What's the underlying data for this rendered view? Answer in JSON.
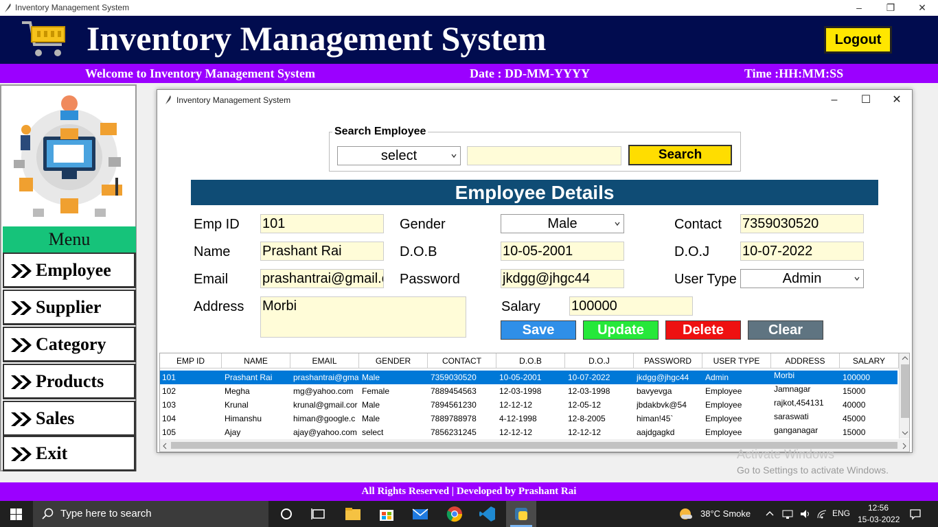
{
  "window": {
    "title": "Inventory Management System"
  },
  "banner": {
    "title": "Inventory Management System",
    "logout_label": "Logout"
  },
  "infobar": {
    "welcome": "Welcome to Inventory Management System",
    "date": "Date : DD-MM-YYYY",
    "time": "Time :HH:MM:SS"
  },
  "menu": {
    "heading": "Menu",
    "items": [
      {
        "label": "Employee"
      },
      {
        "label": "Supplier"
      },
      {
        "label": "Category"
      },
      {
        "label": "Products"
      },
      {
        "label": "Sales"
      },
      {
        "label": "Exit"
      }
    ]
  },
  "inner": {
    "title": "Inventory Management System",
    "search": {
      "legend": "Search Employee",
      "select_value": "select",
      "text_value": "",
      "button_label": "Search"
    },
    "details_heading": "Employee Details",
    "form": {
      "emp_id": {
        "label": "Emp ID",
        "value": "101"
      },
      "gender": {
        "label": "Gender",
        "value": "Male"
      },
      "contact": {
        "label": "Contact",
        "value": "7359030520"
      },
      "name": {
        "label": "Name",
        "value": "Prashant Rai"
      },
      "dob": {
        "label": "D.O.B",
        "value": "10-05-2001"
      },
      "doj": {
        "label": "D.O.J",
        "value": "10-07-2022"
      },
      "email": {
        "label": "Email",
        "value": "prashantrai@gmail.c"
      },
      "password": {
        "label": "Password",
        "value": "jkdgg@jhgc44"
      },
      "user_type": {
        "label": "User Type",
        "value": "Admin"
      },
      "address": {
        "label": "Address",
        "value": "Morbi"
      },
      "salary": {
        "label": "Salary",
        "value": "100000"
      }
    },
    "buttons": {
      "save": "Save",
      "update": "Update",
      "delete": "Delete",
      "clear": "Clear",
      "save_color": "#2f8fe8",
      "update_color": "#26e83a",
      "delete_color": "#ee1111",
      "clear_color": "#5f7481"
    },
    "table": {
      "columns": [
        "EMP ID",
        "NAME",
        "EMAIL",
        "GENDER",
        "CONTACT",
        "D.O.B",
        "D.O.J",
        "PASSWORD",
        "USER TYPE",
        "ADDRESS",
        "SALARY"
      ],
      "rows": [
        [
          "101",
          "Prashant Rai",
          "prashantrai@gma",
          "Male",
          "7359030520",
          "10-05-2001",
          "10-07-2022",
          "jkdgg@jhgc44",
          "Admin",
          "Morbi",
          "100000"
        ],
        [
          "102",
          "Megha",
          "mg@yahoo.com",
          "Female",
          "7889454563",
          "12-03-1998",
          "12-03-1998",
          "bavyevga",
          "Employee",
          "Jamnagar",
          "15000"
        ],
        [
          "103",
          "Krunal",
          "krunal@gmail.cor",
          "Male",
          "7894561230",
          "12-12-12",
          "12-05-12",
          "jbdakbvk@54",
          "Employee",
          "rajkot,454131",
          "40000"
        ],
        [
          "104",
          "Himanshu",
          "himan@google.c",
          "Male",
          "7889788978",
          "4-12-1998",
          "12-8-2005",
          "himan!45`",
          "Employee",
          "saraswati",
          "45000"
        ],
        [
          "105",
          "Ajay",
          "ajay@yahoo.com",
          "select",
          "7856231245",
          "12-12-12",
          "12-12-12",
          "aajdgagkd",
          "Employee",
          "ganganagar",
          "15000"
        ]
      ]
    }
  },
  "watermark": {
    "line1": "Activate Windows",
    "line2": "Go to Settings to activate Windows."
  },
  "footer": {
    "text": "All Rights Reserved | Developed by Prashant Rai"
  },
  "taskbar": {
    "search_placeholder": "Type here to search",
    "weather": "38°C  Smoke",
    "lang": "ENG",
    "time": "12:56",
    "date": "15-03-2022"
  },
  "colors": {
    "banner": "#010c4f",
    "purple": "#9b00ff",
    "menu_head": "#16c37a",
    "details_head": "#0f4c75",
    "entry_bg": "#fffcd8",
    "selection": "#0078d7"
  }
}
